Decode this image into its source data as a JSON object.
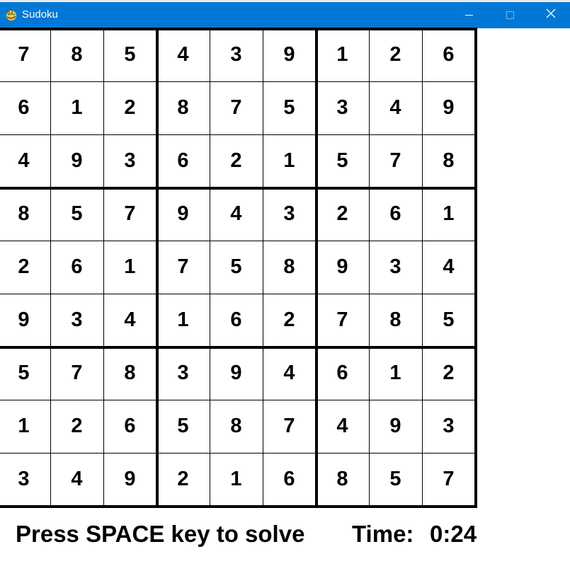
{
  "window": {
    "title": "Sudoku",
    "app_icon": "pygame-snake-icon",
    "controls": [
      "minimize-icon",
      "maximize-icon",
      "close-icon"
    ],
    "titlebar_color": "#0078d7"
  },
  "board": {
    "rows": [
      [
        7,
        8,
        5,
        4,
        3,
        9,
        1,
        2,
        6
      ],
      [
        6,
        1,
        2,
        8,
        7,
        5,
        3,
        4,
        9
      ],
      [
        4,
        9,
        3,
        6,
        2,
        1,
        5,
        7,
        8
      ],
      [
        8,
        5,
        7,
        9,
        4,
        3,
        2,
        6,
        1
      ],
      [
        2,
        6,
        1,
        7,
        5,
        8,
        9,
        3,
        4
      ],
      [
        9,
        3,
        4,
        1,
        6,
        2,
        7,
        8,
        5
      ],
      [
        5,
        7,
        8,
        3,
        9,
        4,
        6,
        1,
        2
      ],
      [
        1,
        2,
        6,
        5,
        8,
        7,
        4,
        9,
        3
      ],
      [
        3,
        4,
        9,
        2,
        1,
        6,
        8,
        5,
        7
      ]
    ]
  },
  "footer": {
    "instruction": "Press SPACE key to solve",
    "timer_label": "Time:",
    "timer_value": "0:24"
  }
}
